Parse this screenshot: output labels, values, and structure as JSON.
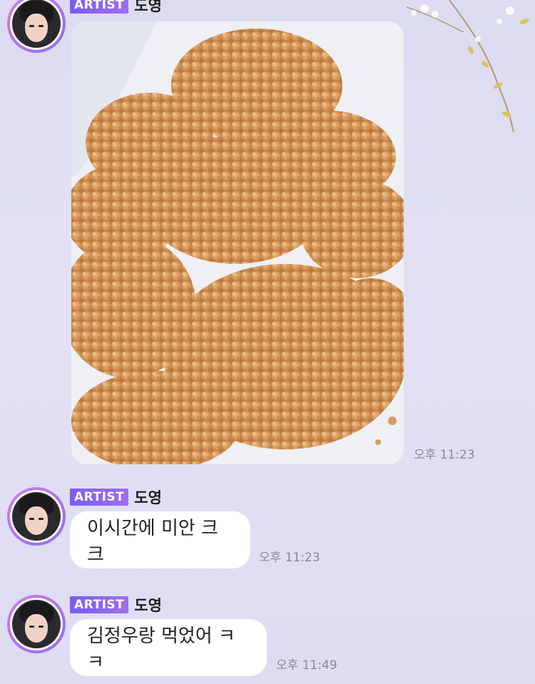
{
  "messages": [
    {
      "type": "photo",
      "badge": "ARTIST",
      "sender": "도영",
      "time": "오후 11:23"
    },
    {
      "type": "text",
      "badge": "ARTIST",
      "sender": "도영",
      "text": "이시간에 미안 크크",
      "time": "오후 11:23"
    },
    {
      "type": "text",
      "badge": "ARTIST",
      "sender": "도영",
      "text": "김정우랑 먹었어 ㅋㅋ",
      "time": "오후 11:49"
    }
  ],
  "colors": {
    "badge_start": "#7a5cf5",
    "badge_end": "#a06ee8",
    "background": "#dedcf2",
    "bubble": "#ffffff"
  }
}
